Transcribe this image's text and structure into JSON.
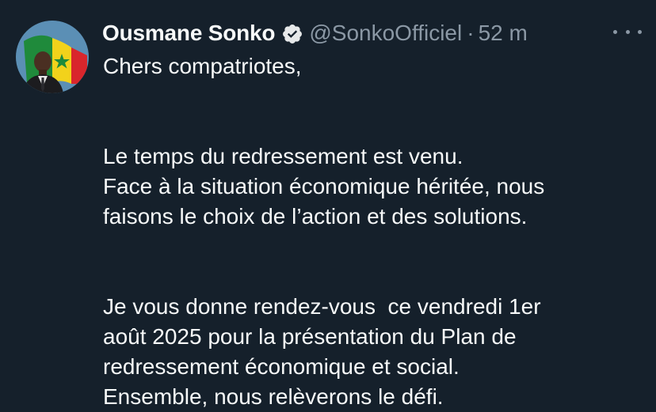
{
  "author": {
    "name": "Ousmane Sonko",
    "handle": "@SonkoOfficiel",
    "separator": "·",
    "time": "52 m",
    "verified": true
  },
  "icons": {
    "verified": "verified-badge-icon",
    "more": "more-horizontal-icon"
  },
  "colors": {
    "background": "#15202b",
    "text": "#f7f9f9",
    "secondary": "#8b98a5",
    "verified_badge": "#e7e9ea"
  },
  "tweet": {
    "paragraphs": [
      [
        "Chers compatriotes,"
      ],
      [
        "Le temps du redressement est venu.",
        "Face à la situation économique héritée, nous",
        "faisons le choix de l’action et des solutions."
      ],
      [
        "Je vous donne rendez-vous  ce vendredi 1er",
        "août 2025 pour la présentation du Plan de",
        "redressement économique et social.",
        "Ensemble, nous relèverons le défi."
      ]
    ]
  }
}
